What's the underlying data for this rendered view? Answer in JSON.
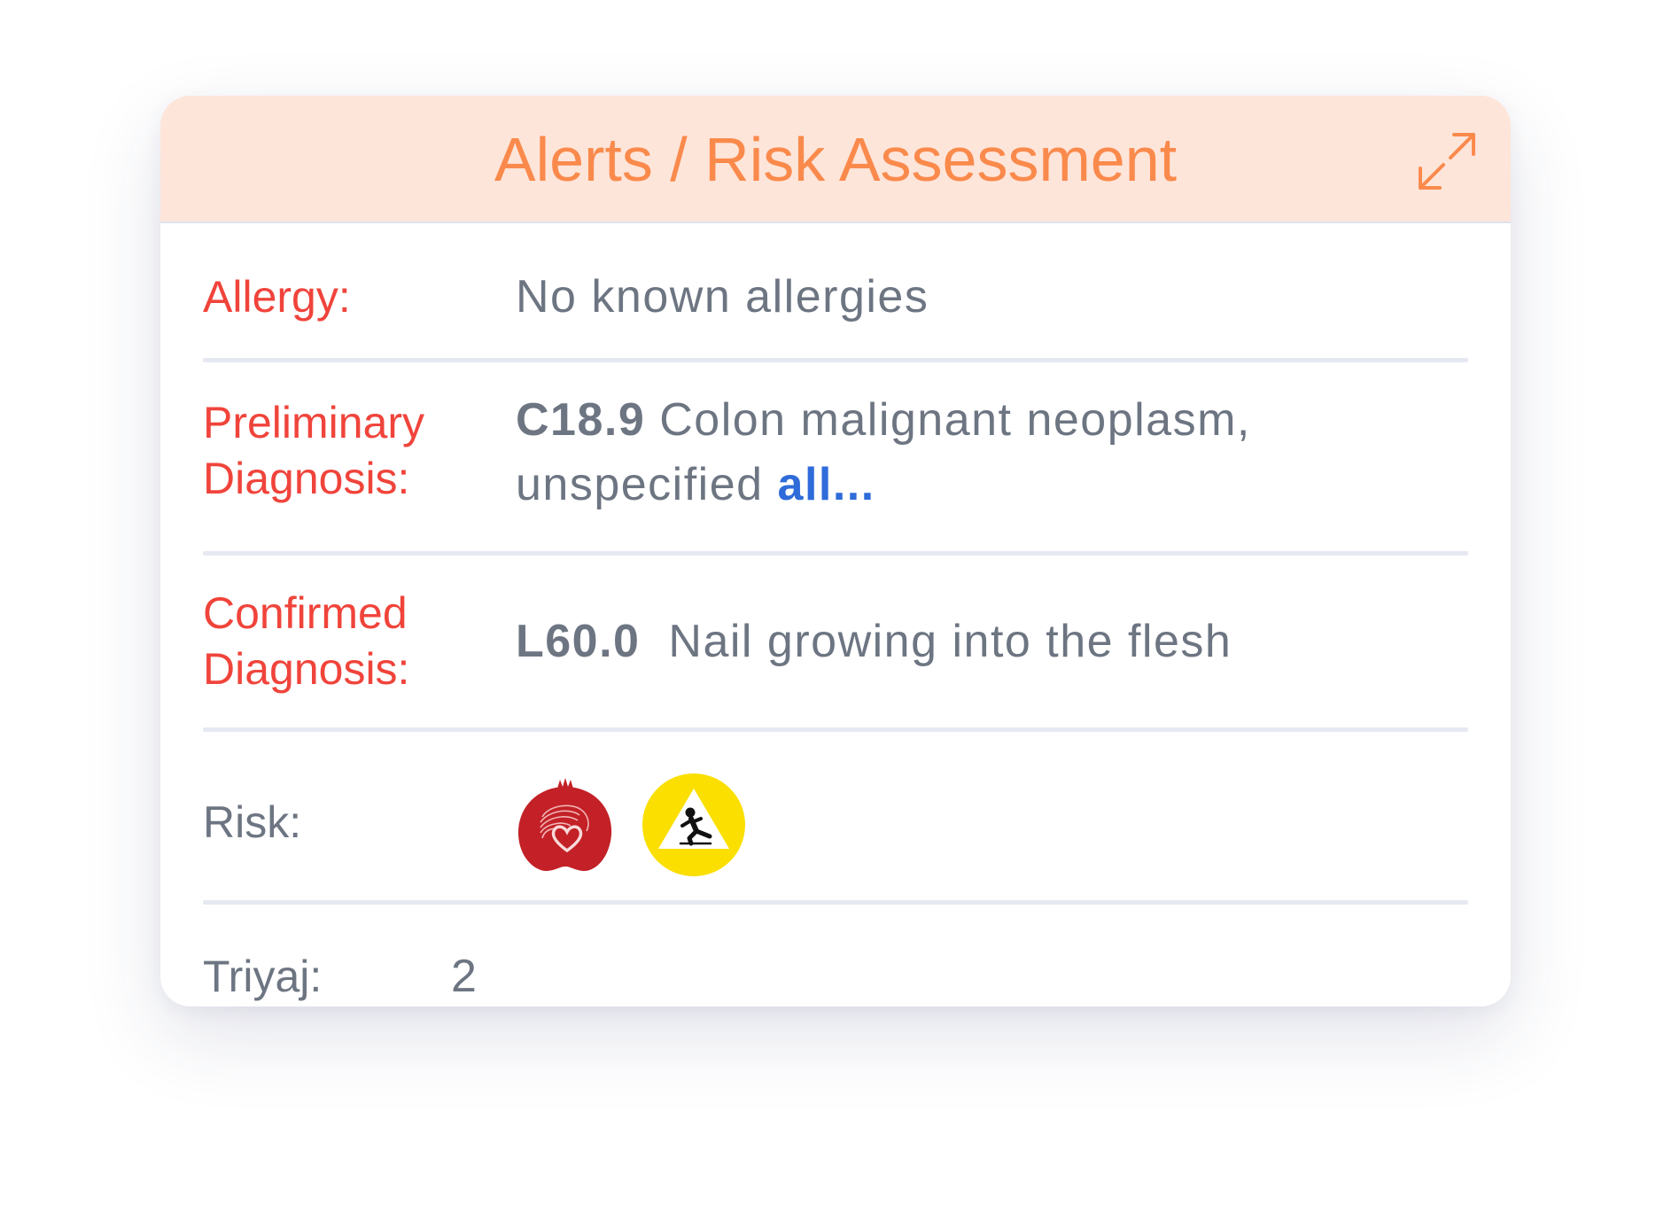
{
  "card": {
    "title": "Alerts / Risk Assessment",
    "expand_icon": "expand-arrows-icon",
    "accent_color": "#fa8a4c",
    "header_bg": "#fee5da"
  },
  "allergy": {
    "label": "Allergy:",
    "value": "No known allergies"
  },
  "preliminary_diagnosis": {
    "label_line1": "Preliminary",
    "label_line2": "Diagnosis:",
    "code": "C18.9",
    "text_line1": "Colon malignant neoplasm,",
    "text_line2": "unspecified",
    "more_link": "all..."
  },
  "confirmed_diagnosis": {
    "label_line1": "Confirmed",
    "label_line2": "Diagnosis:",
    "code": "L60.0",
    "text": "Nail growing into the flesh"
  },
  "risk": {
    "label": "Risk:",
    "icons": [
      {
        "name": "pomegranate-risk-icon",
        "color": "#c32127"
      },
      {
        "name": "fall-risk-icon",
        "color": "#fadf00"
      }
    ]
  },
  "triage": {
    "label": "Triyaj:",
    "value": "2"
  },
  "colors": {
    "label_red": "#f0443b",
    "text_grey": "#6d7582",
    "link_blue": "#2f6bd9"
  }
}
